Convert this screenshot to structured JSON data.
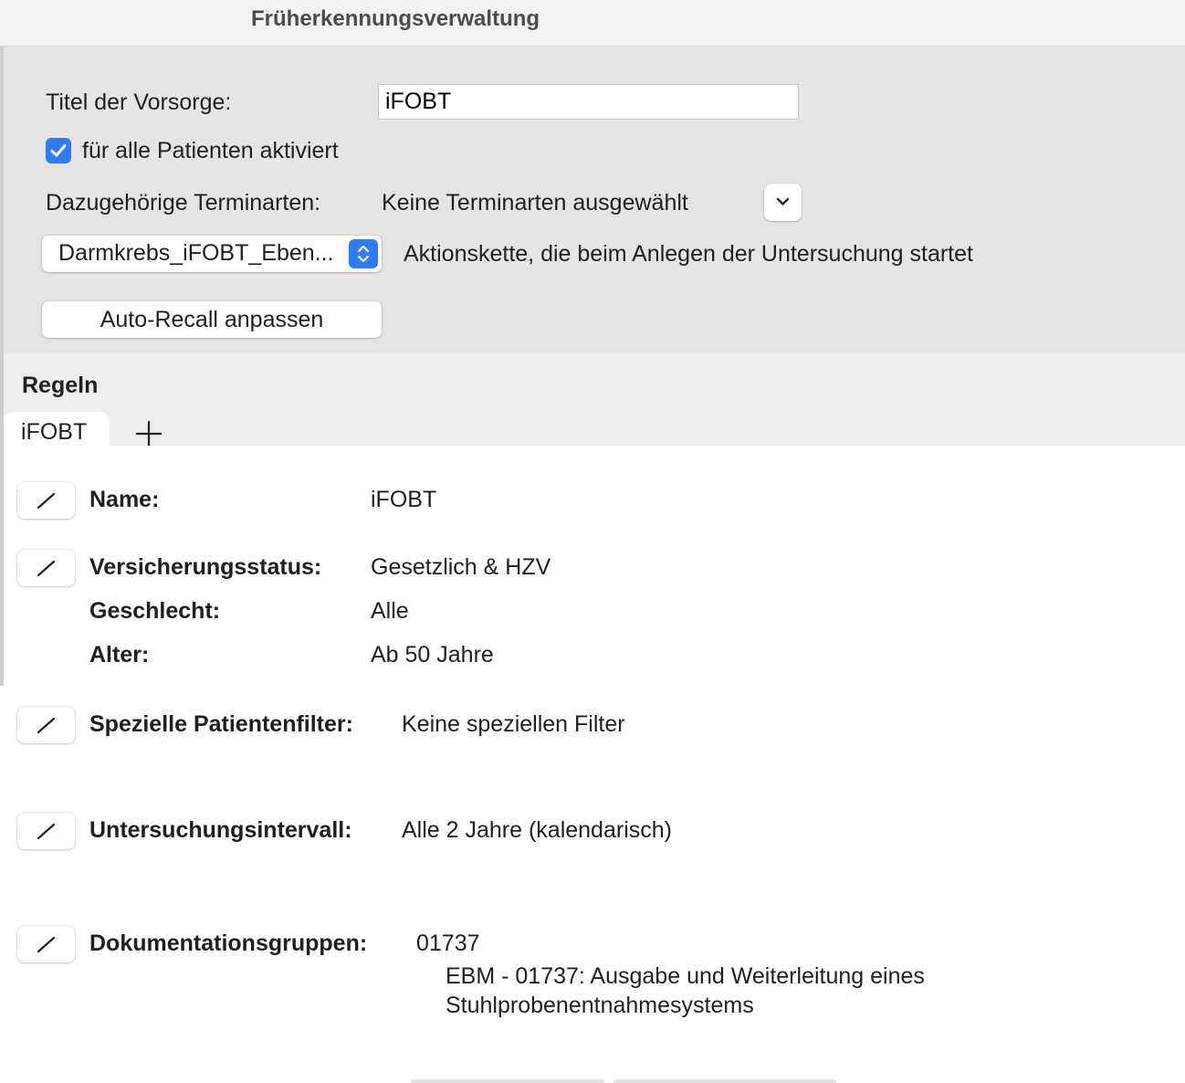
{
  "window": {
    "title": "Früherkennungsverwaltung"
  },
  "settings": {
    "title_label": "Titel der Vorsorge:",
    "title_value": "iFOBT",
    "activated_label": "für alle Patienten aktiviert",
    "activated_checked": true,
    "appointment_types_label": "Dazugehörige Terminarten:",
    "appointment_types_value": "Keine Terminarten ausgewählt",
    "action_chain_selected": "Darmkrebs_iFOBT_Eben...",
    "action_chain_description": "Aktionskette, die beim Anlegen der Untersuchung startet",
    "auto_recall_button": "Auto-Recall anpassen"
  },
  "rules": {
    "heading": "Regeln",
    "tabs": [
      {
        "label": "iFOBT",
        "selected": true
      }
    ],
    "add_tab_icon": "plus-icon",
    "name_label": "Name:",
    "name_value": "iFOBT",
    "insurance_label": "Versicherungsstatus:",
    "insurance_value": "Gesetzlich & HZV",
    "gender_label": "Geschlecht:",
    "gender_value": "Alle",
    "age_label": "Alter:",
    "age_value": "Ab 50 Jahre",
    "filter_label": "Spezielle Patientenfilter:",
    "filter_value": "Keine speziellen Filter",
    "interval_label": "Untersuchungsintervall:",
    "interval_value": "Alle 2 Jahre (kalendarisch)",
    "docgroups_label": "Dokumentationsgruppen:",
    "docgroups_code": "01737",
    "docgroups_desc_line1": "EBM - 01737: Ausgabe und Weiterleitung eines",
    "docgroups_desc_line2": "Stuhlprobenentnahmesystems"
  },
  "colors": {
    "accent": "#2f7cf6",
    "settings_bg": "#e6e5e4",
    "titlebar_bg": "#f4f3f2"
  },
  "icons": {
    "edit": "pencil-icon",
    "dropdown": "chevron-down-icon",
    "stepper": "up-down-chevron-icon",
    "check": "checkmark-icon"
  }
}
